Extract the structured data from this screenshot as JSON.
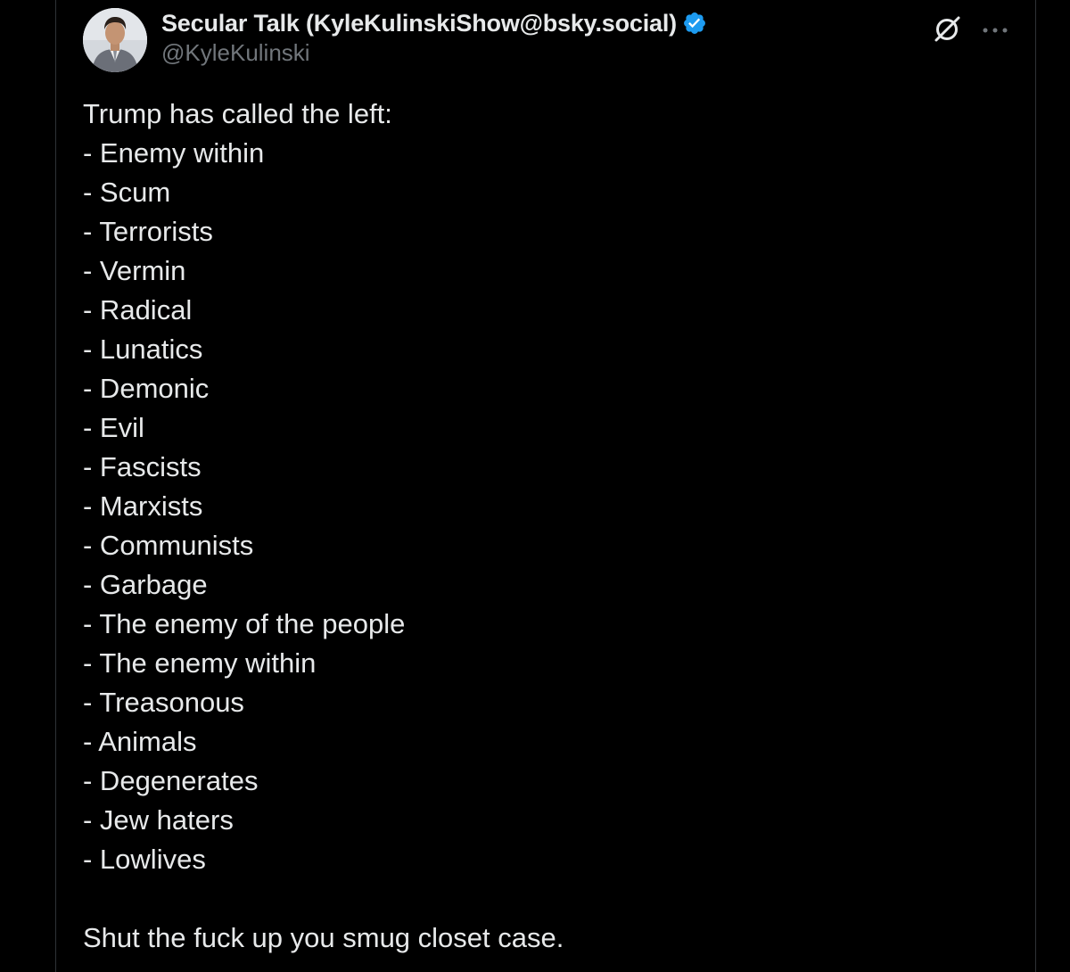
{
  "post": {
    "author": {
      "display_name": "Secular Talk (KyleKulinskiShow@bsky.social)",
      "handle": "@KyleKulinski",
      "verified": true,
      "verified_color": "#1d9bf0"
    },
    "intro": "Trump has called the left:",
    "items": [
      "- Enemy within",
      "- Scum",
      "- Terrorists",
      "- Vermin",
      "- Radical",
      "- Lunatics",
      "- Demonic",
      "- Evil",
      "- Fascists",
      "- Marxists",
      "- Communists",
      "- Garbage",
      "- The enemy of the people",
      "- The enemy within",
      "- Treasonous",
      "- Animals",
      "- Degenerates",
      "- Jew haters",
      "- Lowlives"
    ],
    "closing": "Shut the fuck up you smug closet case."
  },
  "icons": {
    "avatar": "profile-photo",
    "verified": "verified-badge-icon",
    "grok": "grok-icon",
    "more": "more-options-icon"
  },
  "colors": {
    "background": "#000000",
    "text": "#e7e9ea",
    "secondary_text": "#71767b",
    "border": "#2f3336"
  }
}
